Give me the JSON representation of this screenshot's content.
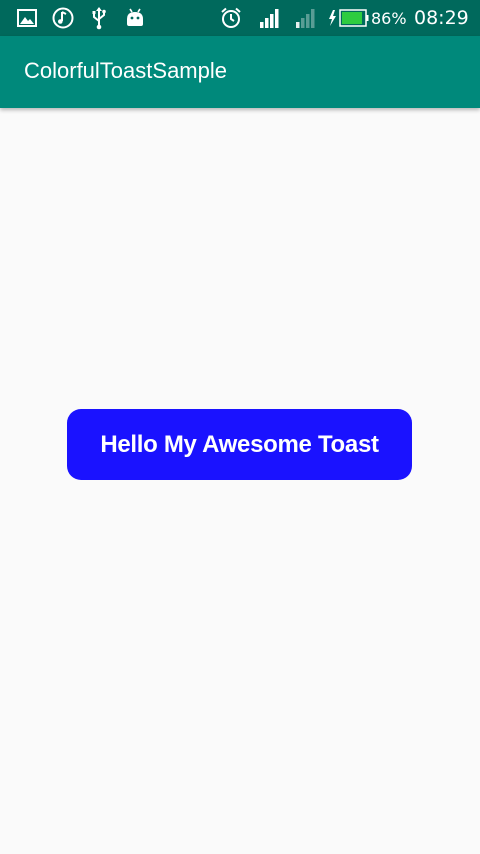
{
  "status_bar": {
    "background": "#00695c",
    "left_icons": [
      "image-icon",
      "music-note-icon",
      "usb-icon",
      "android-icon"
    ],
    "right_icons": [
      "alarm-icon",
      "signal-icon",
      "signal-weak-icon",
      "battery-charging-icon"
    ],
    "battery_percent": "86%",
    "time": "08:29"
  },
  "app_bar": {
    "background": "#00897b",
    "title": "ColorfulToastSample"
  },
  "toast": {
    "background": "#1a12ff",
    "text": "Hello My Awesome Toast"
  }
}
